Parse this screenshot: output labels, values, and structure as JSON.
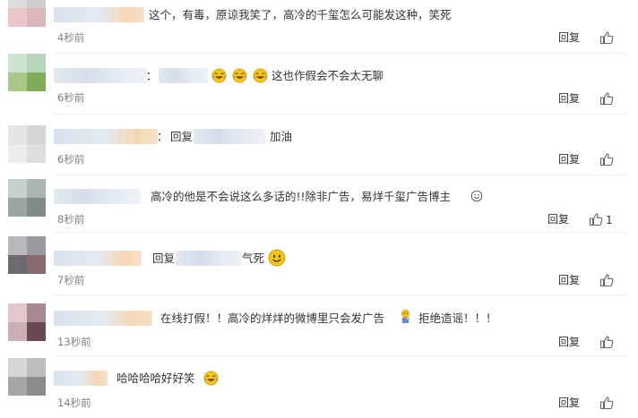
{
  "reply_label": "回复",
  "colors": {
    "text": "#333333",
    "time": "#808080",
    "divider": "#eeeeee",
    "emoji_yellow": "#f5c518"
  },
  "comments": [
    {
      "text": "这个，有毒，原谅我笑了，高冷的千玺怎么可能发这种，笑死",
      "time": "4秒前"
    },
    {
      "colon": "：",
      "text": "这也作假会不会太无聊",
      "time": "6秒前",
      "emojis": [
        "laugh-cry-emoji",
        "laugh-cry-emoji",
        "laugh-cry-emoji"
      ]
    },
    {
      "colon": "：",
      "reply_prefix": "回复",
      "text": "加油",
      "time": "6秒前"
    },
    {
      "text": "高冷的他是不会说这么多话的!!除非广告，易烊千玺广告博主",
      "time": "8秒前",
      "like_count": "1",
      "emojis": [
        "smile-emoji"
      ]
    },
    {
      "reply_prefix": "回复",
      "text": "气死",
      "time": "7秒前",
      "emojis": [
        "smile-emoji"
      ]
    },
    {
      "text": "在线打假！！高冷的烊烊的微博里只会发广告",
      "text2": "拒绝造谣！！！",
      "time": "13秒前",
      "emojis": [
        "thinking-figure-emoji"
      ]
    },
    {
      "text": "哈哈哈哈好好笑",
      "time": "14秒前",
      "emojis": [
        "laugh-cry-emoji"
      ]
    }
  ]
}
